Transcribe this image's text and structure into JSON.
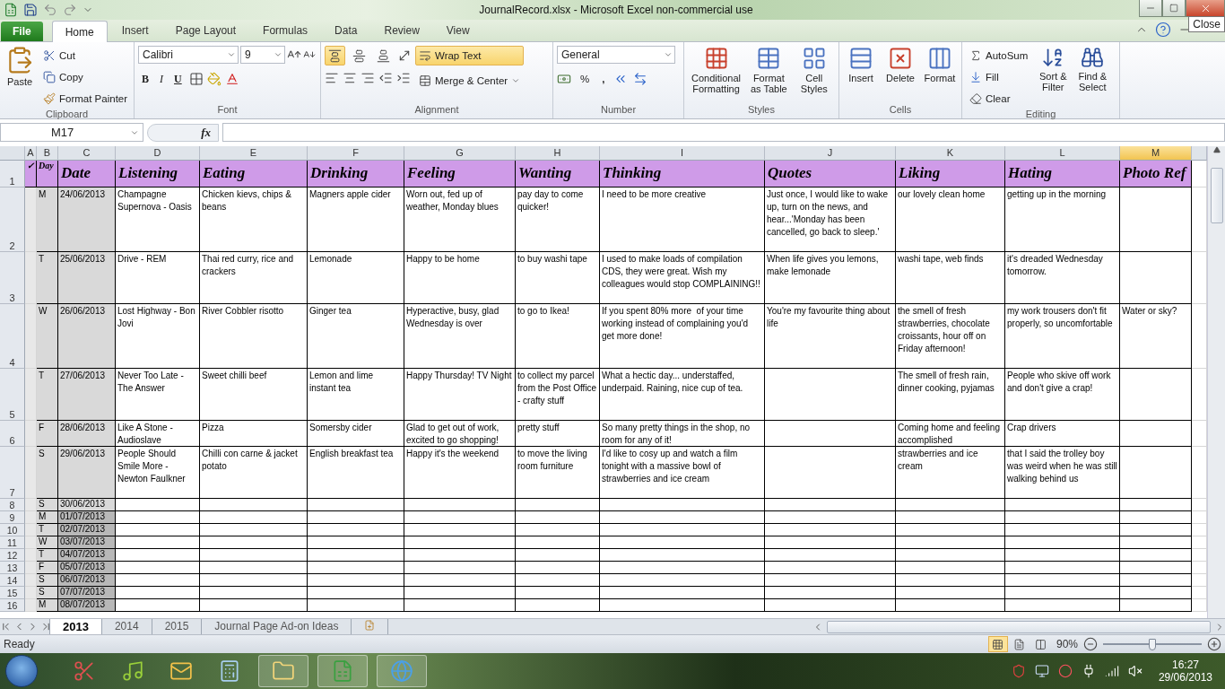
{
  "window": {
    "title": "JournalRecord.xlsx  -  Microsoft Excel non-commercial use",
    "tooltip": "Close"
  },
  "ribbon_tabs": [
    {
      "label": "File",
      "kind": "file",
      "selected": false
    },
    {
      "label": "Home",
      "kind": "tab",
      "selected": true
    },
    {
      "label": "Insert",
      "kind": "tab",
      "selected": false
    },
    {
      "label": "Page Layout",
      "kind": "tab",
      "selected": false
    },
    {
      "label": "Formulas",
      "kind": "tab",
      "selected": false
    },
    {
      "label": "Data",
      "kind": "tab",
      "selected": false
    },
    {
      "label": "Review",
      "kind": "tab",
      "selected": false
    },
    {
      "label": "View",
      "kind": "tab",
      "selected": false
    }
  ],
  "ribbon": {
    "clipboard": {
      "label": "Clipboard",
      "paste": "Paste",
      "cut": "Cut",
      "copy": "Copy",
      "format_painter": "Format Painter"
    },
    "font": {
      "label": "Font",
      "font_name": "Calibri",
      "font_size": "9",
      "bold": "B",
      "italic": "I",
      "underline": "U"
    },
    "alignment": {
      "label": "Alignment",
      "vertical": [
        {
          "selected": true
        },
        {
          "selected": false
        },
        {
          "selected": false
        }
      ],
      "wrap_text": {
        "label": "Wrap Text",
        "on": true
      },
      "merge": "Merge & Center"
    },
    "number": {
      "label": "Number",
      "format": "General",
      "percent": "%",
      "comma": ","
    },
    "styles": {
      "label": "Styles",
      "buttons": [
        "Conditional Formatting",
        "Format as Table",
        "Cell Styles"
      ]
    },
    "cells": {
      "label": "Cells",
      "buttons": [
        "Insert",
        "Delete",
        "Format"
      ]
    },
    "editing": {
      "label": "Editing",
      "autosum": "AutoSum",
      "fill": "Fill",
      "clear": "Clear",
      "sort": "Sort & Filter",
      "find": "Find & Select"
    }
  },
  "formula_bar": {
    "name_box": "M17",
    "fx": "fx"
  },
  "sheet": {
    "columns": [
      {
        "label": "A",
        "selected": false
      },
      {
        "label": "B",
        "selected": false
      },
      {
        "label": "C",
        "selected": false
      },
      {
        "label": "D",
        "selected": false
      },
      {
        "label": "E",
        "selected": false
      },
      {
        "label": "F",
        "selected": false
      },
      {
        "label": "G",
        "selected": false
      },
      {
        "label": "H",
        "selected": false
      },
      {
        "label": "I",
        "selected": false
      },
      {
        "label": "J",
        "selected": false
      },
      {
        "label": "K",
        "selected": false
      },
      {
        "label": "L",
        "selected": false
      },
      {
        "label": "M",
        "selected": true
      }
    ],
    "rows": [
      {
        "num": "1",
        "kind": "header",
        "cells": [
          "✓",
          "Day",
          "Date",
          "Listening",
          "Eating",
          "Drinking",
          "Feeling",
          "Wanting",
          "Thinking",
          "Quotes",
          "Liking",
          "Hating",
          "Photo Ref"
        ]
      },
      {
        "num": "2",
        "kind": "entry",
        "cells": [
          null,
          "M",
          "24/06/2013",
          "Champagne Supernova - Oasis",
          "Chicken kievs, chips & beans",
          "Magners apple cider",
          "Worn out, fed up of weather, Monday blues",
          "pay day to come quicker!",
          "I need to be more creative",
          "Just once, I would like to wake up, turn on the news, and hear...'Monday has been cancelled, go back to sleep.'",
          "our lovely clean home",
          "getting up in the morning",
          null
        ]
      },
      {
        "num": "3",
        "kind": "entry",
        "cells": [
          null,
          "T",
          "25/06/2013",
          "Drive - REM",
          "Thai red curry, rice and crackers",
          "Lemonade",
          "Happy to be home",
          "to buy washi tape",
          "I used to make loads of compilation CDS, they were great. Wish my colleagues would stop COMPLAINING!!",
          "When life gives you lemons, make lemonade",
          "washi tape, web finds",
          "it's dreaded Wednesday tomorrow.",
          null
        ]
      },
      {
        "num": "4",
        "kind": "entry",
        "cells": [
          null,
          "W",
          "26/06/2013",
          "Lost Highway - Bon Jovi",
          "River Cobbler risotto",
          "Ginger tea",
          "Hyperactive, busy, glad Wednesday is over",
          "to go to Ikea!",
          "If you spent 80% more  of your time working instead of complaining you'd get more done!",
          "You're my favourite thing about life",
          "the smell of fresh strawberries, chocolate croissants, hour off on Friday afternoon!",
          "my work trousers don't fit properly, so uncomfortable",
          "Water or sky?"
        ]
      },
      {
        "num": "5",
        "kind": "entry",
        "cells": [
          null,
          "T",
          "27/06/2013",
          "Never Too Late - The Answer",
          "Sweet chilli beef",
          "Lemon and lime instant tea",
          "Happy Thursday! TV Night",
          "to collect my parcel from the Post Office - crafty stuff",
          "What a hectic day... understaffed, underpaid. Raining, nice cup of tea.",
          null,
          "The smell of fresh rain, dinner cooking, pyjamas",
          "People who skive off work and don't give a crap!",
          null
        ]
      },
      {
        "num": "6",
        "kind": "entry",
        "cells": [
          null,
          "F",
          "28/06/2013",
          "Like A Stone - Audioslave",
          "Pizza",
          "Somersby cider",
          "Glad to get out of work, excited to go shopping!",
          "pretty stuff",
          "So many pretty things in the shop, no room for any of it!",
          null,
          "Coming home and feeling accomplished",
          "Crap drivers",
          null
        ]
      },
      {
        "num": "7",
        "kind": "entry",
        "cells": [
          null,
          "S",
          "29/06/2013",
          "People Should Smile More - Newton Faulkner",
          "Chilli con carne & jacket potato",
          "English breakfast tea",
          "Happy it's the weekend",
          "to move the living room furniture",
          "I'd like to cosy up and watch a film tonight with a massive bowl of strawberries and ice cream",
          null,
          "strawberries and ice cream",
          "that I said the trolley boy was weird when he was still walking behind us",
          null
        ]
      },
      {
        "num": "8",
        "kind": "entry",
        "cells": [
          null,
          "S",
          "30/06/2013",
          null,
          null,
          null,
          null,
          null,
          null,
          null,
          null,
          null,
          null
        ]
      },
      {
        "num": "9",
        "kind": "entry",
        "cells": [
          null,
          "M",
          "01/07/2013",
          null,
          null,
          null,
          null,
          null,
          null,
          null,
          null,
          null,
          null
        ]
      },
      {
        "num": "10",
        "kind": "entry",
        "cells": [
          null,
          "T",
          "02/07/2013",
          null,
          null,
          null,
          null,
          null,
          null,
          null,
          null,
          null,
          null
        ]
      },
      {
        "num": "11",
        "kind": "entry",
        "cells": [
          null,
          "W",
          "03/07/2013",
          null,
          null,
          null,
          null,
          null,
          null,
          null,
          null,
          null,
          null
        ]
      },
      {
        "num": "12",
        "kind": "entry",
        "cells": [
          null,
          "T",
          "04/07/2013",
          null,
          null,
          null,
          null,
          null,
          null,
          null,
          null,
          null,
          null
        ]
      },
      {
        "num": "13",
        "kind": "entry",
        "cells": [
          null,
          "F",
          "05/07/2013",
          null,
          null,
          null,
          null,
          null,
          null,
          null,
          null,
          null,
          null
        ]
      },
      {
        "num": "14",
        "kind": "entry",
        "cells": [
          null,
          "S",
          "06/07/2013",
          null,
          null,
          null,
          null,
          null,
          null,
          null,
          null,
          null,
          null
        ]
      },
      {
        "num": "15",
        "kind": "entry",
        "cells": [
          null,
          "S",
          "07/07/2013",
          null,
          null,
          null,
          null,
          null,
          null,
          null,
          null,
          null,
          null
        ]
      },
      {
        "num": "16",
        "kind": "entry",
        "cells": [
          null,
          "M",
          "08/07/2013",
          null,
          null,
          null,
          null,
          null,
          null,
          null,
          null,
          null,
          null
        ]
      }
    ]
  },
  "sheet_tabs": [
    {
      "label": "2013",
      "selected": true
    },
    {
      "label": "2014",
      "selected": false
    },
    {
      "label": "2015",
      "selected": false
    },
    {
      "label": "Journal Page Ad-on Ideas",
      "selected": false
    }
  ],
  "status_bar": {
    "status": "Ready",
    "views": [
      {
        "selected": true
      },
      {
        "selected": false
      },
      {
        "selected": false
      }
    ],
    "zoom": "90%",
    "zoom_slider": {
      "level": 0.5
    }
  },
  "taskbar": {
    "time": "16:27",
    "date": "29/06/2013"
  }
}
